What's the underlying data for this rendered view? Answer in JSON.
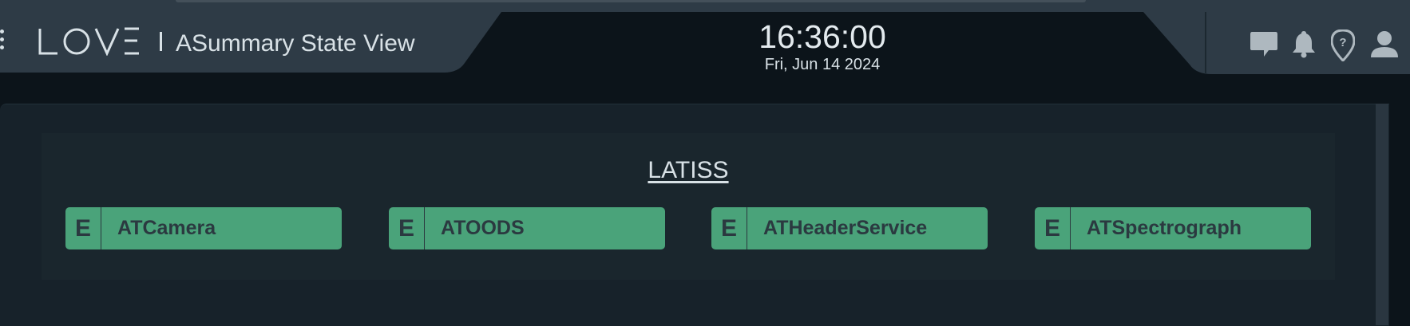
{
  "header": {
    "logo_text": "LOVE",
    "view_title": "ASummary State View",
    "clock_time": "16:36:00",
    "clock_date": "Fri, Jun 14 2024"
  },
  "icons": [
    "chat-icon",
    "bell-icon",
    "help-location-icon",
    "user-icon"
  ],
  "colors": {
    "background": "#0c141a",
    "panel": "#2e3b46",
    "card": "#1a262d",
    "enabled_green": "#4aa37a",
    "text": "#d8e1e6"
  },
  "summary": {
    "group_title": "LATISS",
    "cscs": [
      {
        "badge": "E",
        "name": "ATCamera"
      },
      {
        "badge": "E",
        "name": "ATOODS"
      },
      {
        "badge": "E",
        "name": "ATHeaderService"
      },
      {
        "badge": "E",
        "name": "ATSpectrograph"
      }
    ]
  }
}
